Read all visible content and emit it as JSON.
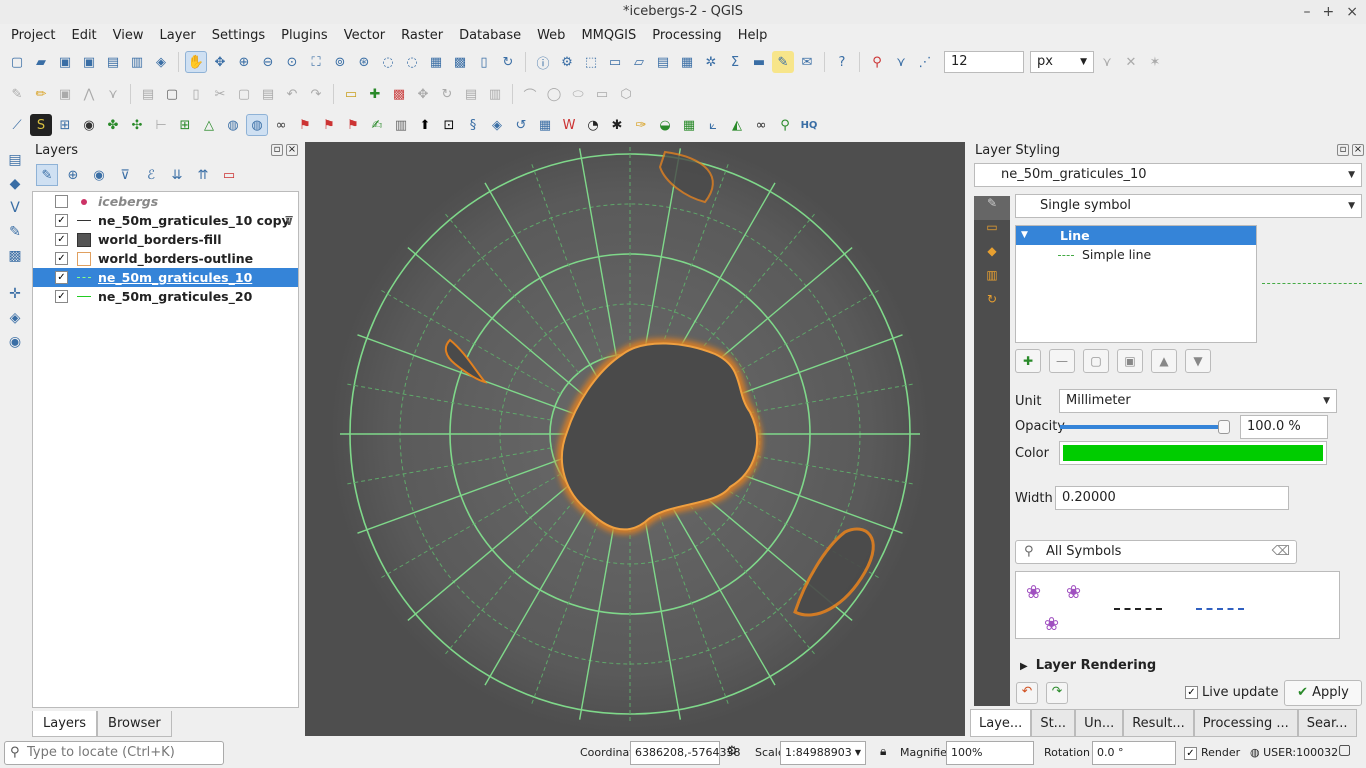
{
  "window": {
    "title": "*icebergs-2 - QGIS"
  },
  "menu": [
    "Project",
    "Edit",
    "View",
    "Layer",
    "Settings",
    "Plugins",
    "Vector",
    "Raster",
    "Database",
    "Web",
    "MMQGIS",
    "Processing",
    "Help"
  ],
  "snapping": {
    "tolerance": "12",
    "unit": "px"
  },
  "layers_panel": {
    "title": "Layers",
    "items": [
      {
        "name": "icebergs",
        "checked": false,
        "symbol": "point"
      },
      {
        "name": "ne_50m_graticules_10 copy",
        "checked": true,
        "symbol": "line-dark"
      },
      {
        "name": "world_borders-fill",
        "checked": true,
        "symbol": "fill-dark"
      },
      {
        "name": "world_borders-outline",
        "checked": true,
        "symbol": "fill-outline"
      },
      {
        "name": "ne_50m_graticules_10",
        "checked": true,
        "symbol": "line-dashed",
        "selected": true
      },
      {
        "name": "ne_50m_graticules_20",
        "checked": true,
        "symbol": "line-green"
      }
    ],
    "tabs": [
      "Layers",
      "Browser"
    ]
  },
  "styling": {
    "title": "Layer Styling",
    "layer": "ne_50m_graticules_10",
    "renderer": "Single symbol",
    "tree": {
      "root": "Line",
      "child": "Simple line"
    },
    "unit_label": "Unit",
    "unit": "Millimeter",
    "opacity_label": "Opacity",
    "opacity": "100.0 %",
    "opacity_value": 1.0,
    "color_label": "Color",
    "color": "#00cc00",
    "width_label": "Width",
    "width": "0.20000",
    "symbols_search": "All Symbols",
    "layer_rendering": "Layer Rendering",
    "live_update": "Live update",
    "apply": "Apply"
  },
  "dock_tabs": [
    "Laye...",
    "St...",
    "Un...",
    "Result...",
    "Processing ...",
    "Sear..."
  ],
  "status": {
    "locate_placeholder": "Type to locate (Ctrl+K)",
    "coordinate_label": "Coordinate",
    "coordinate": "6386208,-5764338",
    "scale_label": "Scale",
    "scale": "1:84988903",
    "magnifier_label": "Magnifier",
    "magnifier": "100%",
    "rotation_label": "Rotation",
    "rotation": "0.0 °",
    "render_label": "Render",
    "crs": "USER:100032"
  }
}
